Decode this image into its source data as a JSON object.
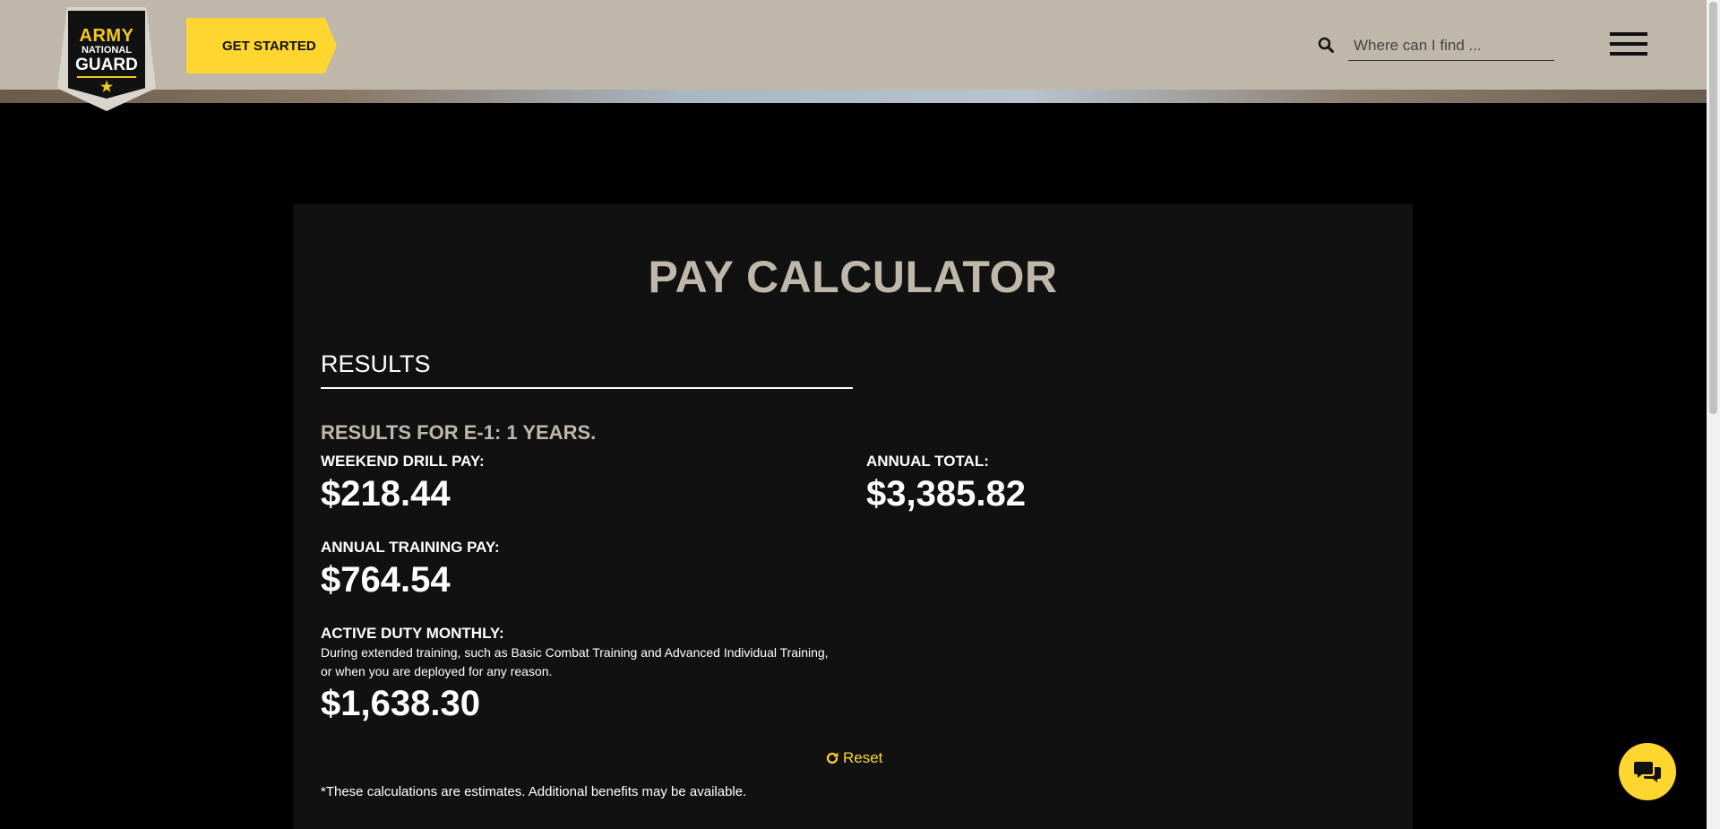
{
  "header": {
    "logo": {
      "line1": "ARMY",
      "line2": "NATIONAL",
      "line3": "GUARD",
      "star": "★"
    },
    "get_started_label": "GET STARTED",
    "search_placeholder": "Where can I find ...",
    "search_value": "",
    "icons": {
      "search": "search-icon",
      "menu": "hamburger-menu-icon"
    }
  },
  "calculator": {
    "title": "PAY CALCULATOR",
    "results_heading": "RESULTS",
    "results_for": "RESULTS FOR E-1: 1 YEARS.",
    "weekend_drill_label": "WEEKEND DRILL PAY:",
    "weekend_drill_amount": "$218.44",
    "annual_total_label": "ANNUAL TOTAL:",
    "annual_total_amount": "$3,385.82",
    "annual_training_label": "ANNUAL TRAINING PAY:",
    "annual_training_amount": "$764.54",
    "active_duty_label": "ACTIVE DUTY MONTHLY:",
    "active_duty_desc_line1": "During extended training, such as Basic Combat Training and Advanced Individual Training,",
    "active_duty_desc_line2": "or when you are deployed for any reason.",
    "active_duty_amount": "$1,638.30",
    "reset_label": "Reset",
    "footnote": "*These calculations are estimates. Additional benefits may be available."
  },
  "chat": {
    "icon": "chat-bubbles-icon"
  },
  "colors": {
    "header_bg": "#bfb8aa",
    "accent_yellow": "#ffd530",
    "panel_bg": "#111111",
    "title_tan": "#bfb8aa"
  }
}
